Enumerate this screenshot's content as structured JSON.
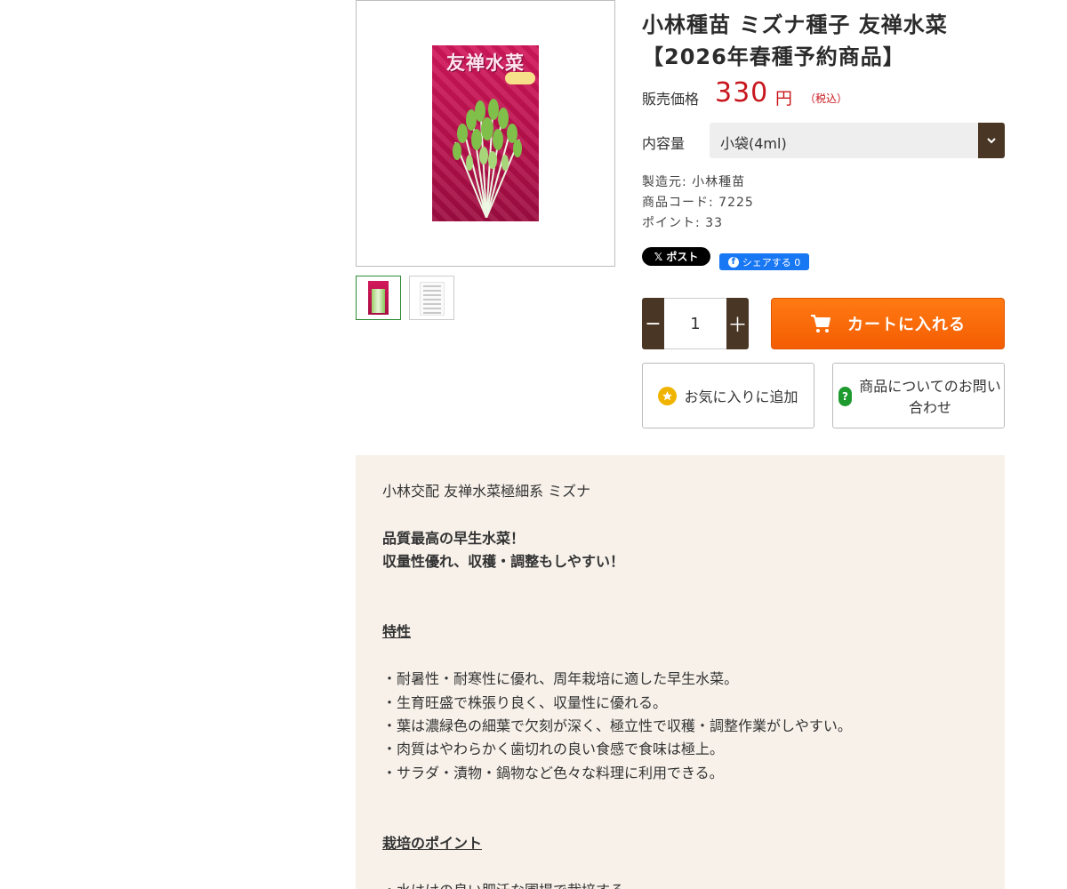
{
  "product": {
    "title": "小林種苗 ミズナ種子 友禅水菜【2026年春種予約商品】",
    "image": {
      "packet_title": "友禅水菜"
    },
    "price": {
      "label": "販売価格",
      "value": "330",
      "unit": "円",
      "tax": "（税込）"
    },
    "capacity": {
      "label": "内容量",
      "selected": "小袋(4ml)"
    },
    "meta": {
      "maker": "製造元: 小林種苗",
      "code": "商品コード: 7225",
      "points": "ポイント: 33"
    },
    "share": {
      "x_label": "ポスト",
      "fb_label": "シェアする 0"
    },
    "quantity": {
      "value": "1",
      "minus": "−",
      "plus": "＋"
    },
    "cart_label": "カートに入れる",
    "favorite_label": "お気に入りに追加",
    "inquiry_label": "商品についてのお問い合わせ"
  },
  "description": {
    "intro": "小林交配 友禅水菜極細系 ミズナ",
    "catch_1": "品質最高の早生水菜！",
    "catch_2": "収量性優れ、収穫・調整もしやすい！",
    "features_heading": "特性",
    "features": [
      "・耐暑性・耐寒性に優れ、周年栽培に適した早生水菜。",
      "・生育旺盛で株張り良く、収量性に優れる。",
      "・葉は濃緑色の細葉で欠刻が深く、極立性で収穫・調整作業がしやすい。",
      "・肉質はやわらかく歯切れの良い食感で食味は極上。",
      "・サラダ・漬物・鍋物など色々な料理に利用できる。"
    ],
    "points_heading": "栽培のポイント",
    "points_first": "・水はけの良い肥沃な圃場で栽培する。"
  },
  "colors": {
    "price": "#c8161d",
    "accent_brown": "#4a3624",
    "cart_orange": "#f45d03",
    "desc_bg": "#f7f1ea"
  }
}
